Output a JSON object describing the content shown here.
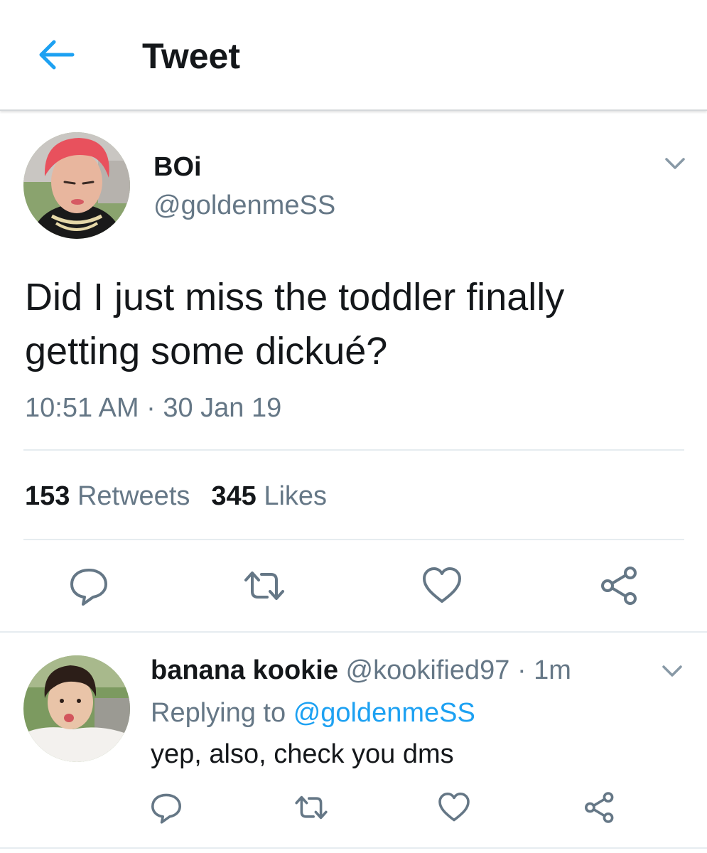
{
  "header": {
    "title": "Tweet",
    "back_icon": "arrow-left-icon"
  },
  "tweet": {
    "author_name": "BOi",
    "author_handle": "@goldenmeSS",
    "text": "Did I just miss the toddler finally getting some dickué?",
    "time": "10:51 AM",
    "date_sep": "·",
    "date": "30 Jan 19",
    "retweets_count": "153",
    "retweets_label": "Retweets",
    "likes_count": "345",
    "likes_label": "Likes"
  },
  "reply": {
    "author_name": "banana kookie",
    "author_handle": "@kookified97",
    "sep": "·",
    "time_ago": "1m",
    "replying_prefix": "Replying to",
    "replying_to": "@goldenmeSS",
    "text": "yep, also, check you dms"
  },
  "colors": {
    "accent": "#1da1f2",
    "text_primary": "#14171a",
    "text_secondary": "#657786",
    "divider": "#e6ecf0"
  },
  "icons": [
    "arrow-left-icon",
    "chevron-down-icon",
    "reply-icon",
    "retweet-icon",
    "heart-icon",
    "share-icon"
  ]
}
